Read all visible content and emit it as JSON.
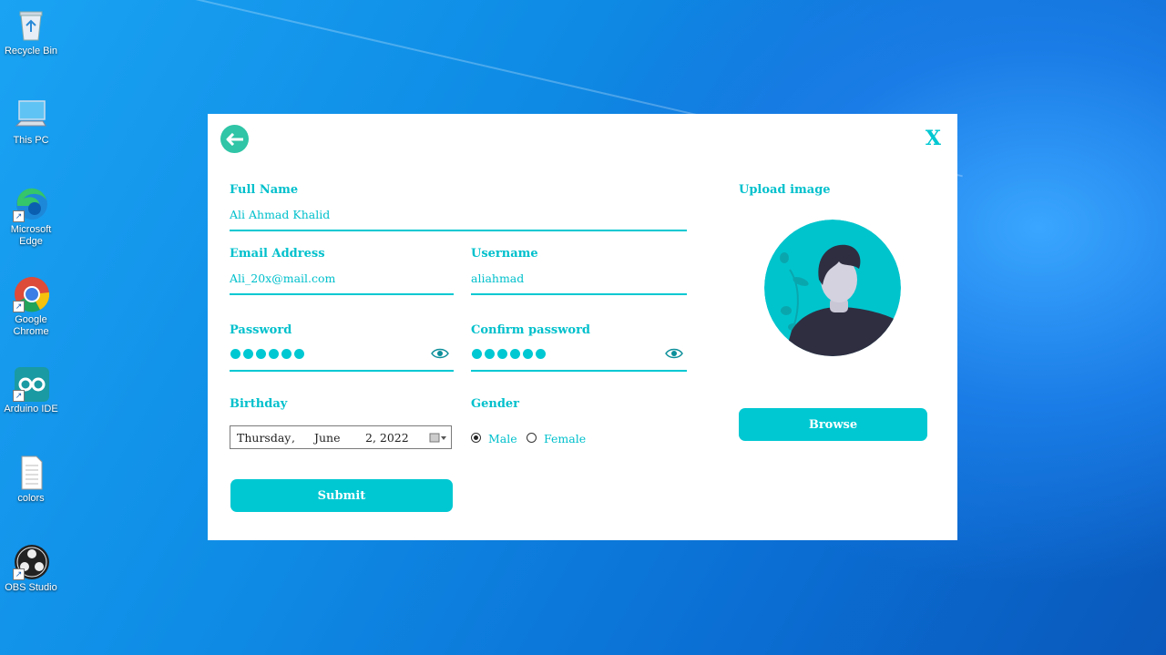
{
  "desktop": {
    "icons": [
      {
        "label": "Recycle Bin"
      },
      {
        "label": "This PC"
      },
      {
        "label": "Microsoft Edge"
      },
      {
        "label": "Google Chrome"
      },
      {
        "label": "Arduino IDE"
      },
      {
        "label": "colors"
      },
      {
        "label": "OBS Studio"
      }
    ]
  },
  "form": {
    "close_label": "X",
    "full_name": {
      "label": "Full Name",
      "value": "Ali Ahmad Khalid"
    },
    "email": {
      "label": "Email Address",
      "value": "Ali_20x@mail.com"
    },
    "username": {
      "label": "Username",
      "value": "aliahmad"
    },
    "password": {
      "label": "Password"
    },
    "confirm_password": {
      "label": "Confirm password"
    },
    "birthday": {
      "label": "Birthday",
      "day": "Thursday",
      "sep": ",",
      "month": "June",
      "date_year": "2, 2022"
    },
    "gender": {
      "label": "Gender",
      "options": [
        "Male",
        "Female"
      ],
      "selected": "Male"
    },
    "submit_label": "Submit",
    "upload": {
      "label": "Upload image",
      "browse_label": "Browse"
    }
  },
  "colors": {
    "accent": "#00c8d2",
    "back_button": "#2fc5a6",
    "avatar_bg": "#00c4cc"
  }
}
